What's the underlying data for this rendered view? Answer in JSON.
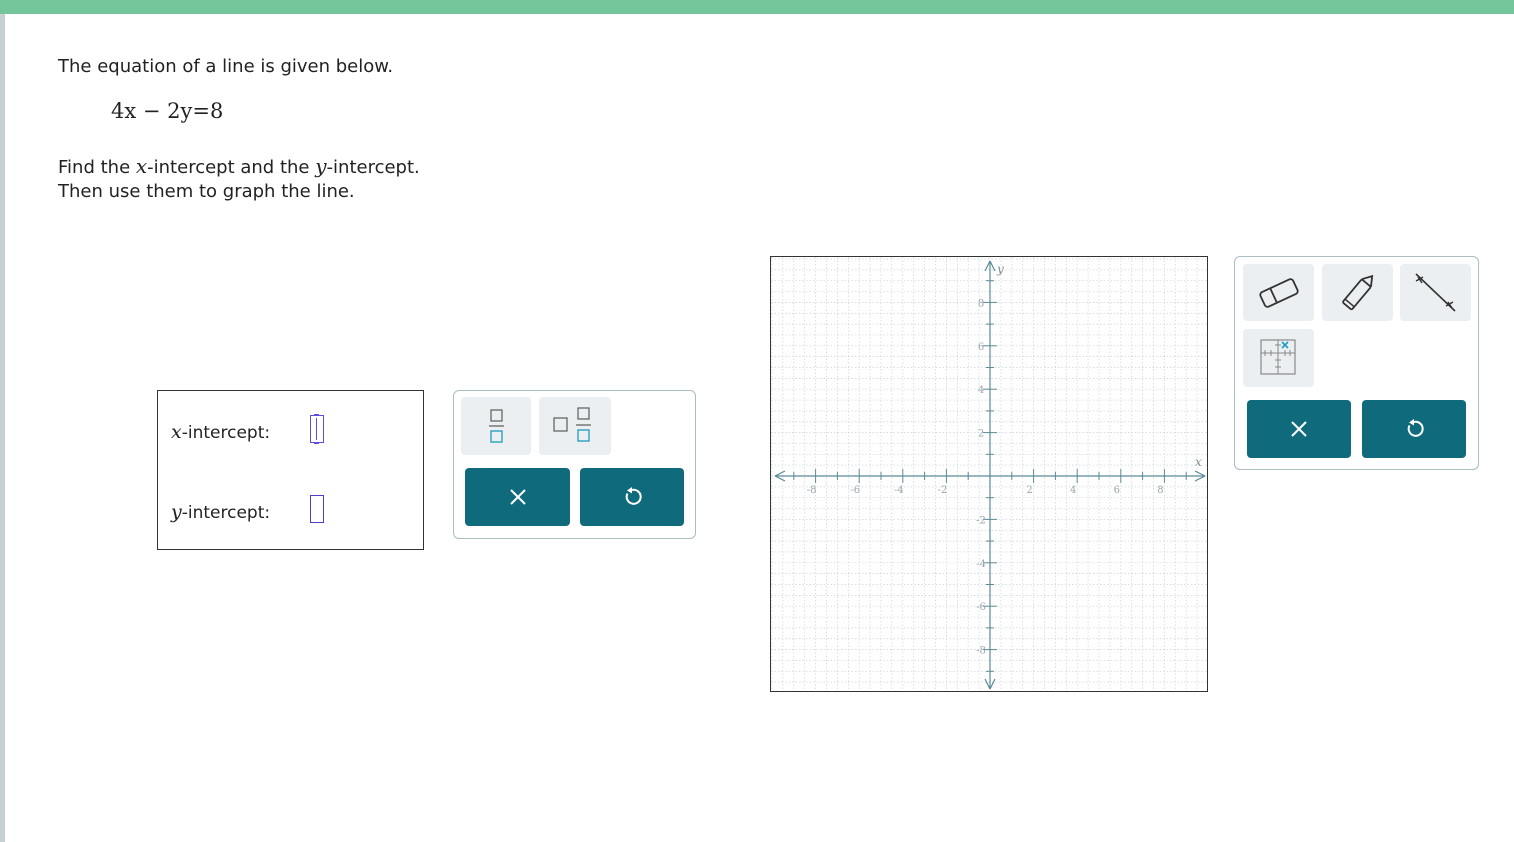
{
  "problem": {
    "intro": "The equation of a line is given below.",
    "equation": {
      "left": "4x − 2y",
      "equals": "=",
      "right": "8"
    },
    "instruction_prefix": "Find the ",
    "x_var": "x",
    "instruction_mid": "-intercept and the ",
    "y_var": "y",
    "instruction_suffix": "-intercept.",
    "instruction_line2": "Then use them to graph the line."
  },
  "answers": {
    "x_label_var": "x",
    "x_label_text": "-intercept:",
    "x_value": "",
    "y_label_var": "y",
    "y_label_text": "-intercept:",
    "y_value": ""
  },
  "keypad": {
    "keys": [
      "fraction-key",
      "mixed-number-key"
    ],
    "clear_icon": "close-icon",
    "undo_icon": "undo-icon"
  },
  "graph": {
    "x_axis_label": "x",
    "y_axis_label": "y",
    "x_tick_labels": [
      "-8",
      "-6",
      "-4",
      "-2",
      "2",
      "4",
      "6",
      "8"
    ],
    "y_tick_labels": [
      "8",
      "6",
      "4",
      "2",
      "-2",
      "-4",
      "-6",
      "-8"
    ],
    "x_range": [
      -10,
      10
    ],
    "y_range": [
      -10,
      10
    ],
    "grid": true
  },
  "tools": {
    "items": [
      "eraser-tool",
      "pencil-tool",
      "line-tool",
      "point-tool"
    ],
    "clear_icon": "close-icon",
    "undo_icon": "undo-icon"
  },
  "colors": {
    "accent": "#0f6b7c",
    "top_bar": "#74c69a",
    "input_border": "#4b3fcf",
    "axis": "#5b8a96"
  }
}
